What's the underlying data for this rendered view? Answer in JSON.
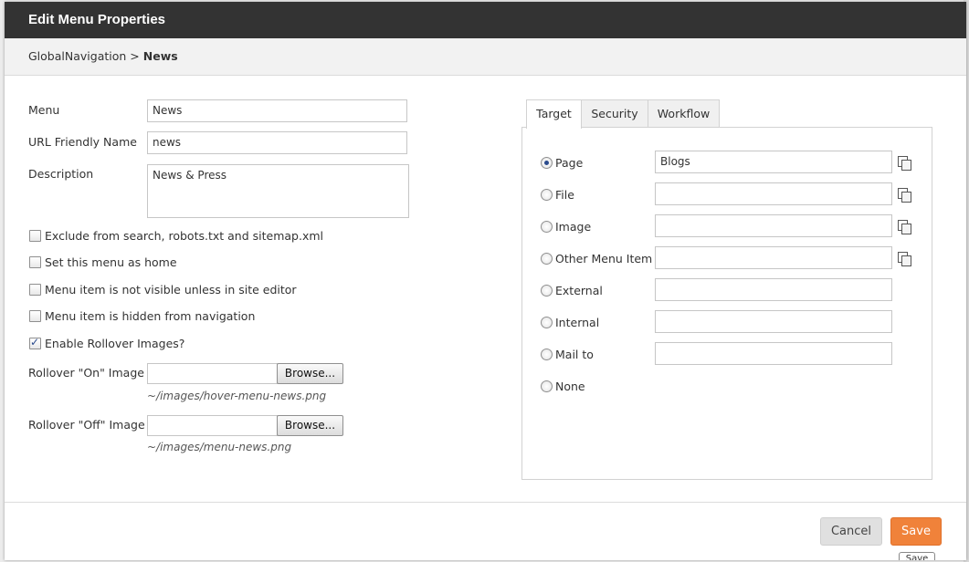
{
  "dialog": {
    "title": "Edit Menu Properties",
    "breadcrumb": {
      "parent": "GlobalNavigation",
      "separator": ">",
      "current": "News"
    }
  },
  "form": {
    "menu": {
      "label": "Menu",
      "value": "News"
    },
    "url_friendly_name": {
      "label": "URL Friendly Name",
      "value": "news"
    },
    "description": {
      "label": "Description",
      "value": "News & Press"
    },
    "checkboxes": [
      {
        "label": "Exclude from search, robots.txt and sitemap.xml",
        "checked": false
      },
      {
        "label": "Set this menu as home",
        "checked": false
      },
      {
        "label": "Menu item is not visible unless in site editor",
        "checked": false
      },
      {
        "label": "Menu item is hidden from navigation",
        "checked": false
      },
      {
        "label": "Enable Rollover Images?",
        "checked": true
      }
    ],
    "rollover_on": {
      "label": "Rollover \"On\" Image",
      "value": "",
      "browse_label": "Browse...",
      "path": "~/images/hover-menu-news.png"
    },
    "rollover_off": {
      "label": "Rollover \"Off\" Image",
      "value": "",
      "browse_label": "Browse...",
      "path": "~/images/menu-news.png"
    }
  },
  "tabs": [
    {
      "label": "Target",
      "active": true
    },
    {
      "label": "Security",
      "active": false
    },
    {
      "label": "Workflow",
      "active": false
    }
  ],
  "target": {
    "options": [
      {
        "label": "Page",
        "selected": true,
        "value": "Blogs",
        "has_input": true,
        "icon": "copy-icon"
      },
      {
        "label": "File",
        "selected": false,
        "value": "",
        "has_input": true,
        "icon": "copy-icon"
      },
      {
        "label": "Image",
        "selected": false,
        "value": "",
        "has_input": true,
        "icon": "copy-icon"
      },
      {
        "label": "Other Menu Item",
        "selected": false,
        "value": "",
        "has_input": true,
        "icon": "copy-icon"
      },
      {
        "label": "External",
        "selected": false,
        "value": "",
        "has_input": true,
        "icon": ""
      },
      {
        "label": "Internal",
        "selected": false,
        "value": "",
        "has_input": true,
        "icon": ""
      },
      {
        "label": "Mail to",
        "selected": false,
        "value": "",
        "has_input": true,
        "icon": ""
      },
      {
        "label": "None",
        "selected": false,
        "value": "",
        "has_input": false,
        "icon": ""
      }
    ]
  },
  "footer": {
    "cancel_label": "Cancel",
    "save_label": "Save",
    "save_tooltip": "Save"
  },
  "colors": {
    "title_bar": "#333333",
    "save_button": "#f0823a",
    "radio_dot": "#2a4b8d"
  }
}
